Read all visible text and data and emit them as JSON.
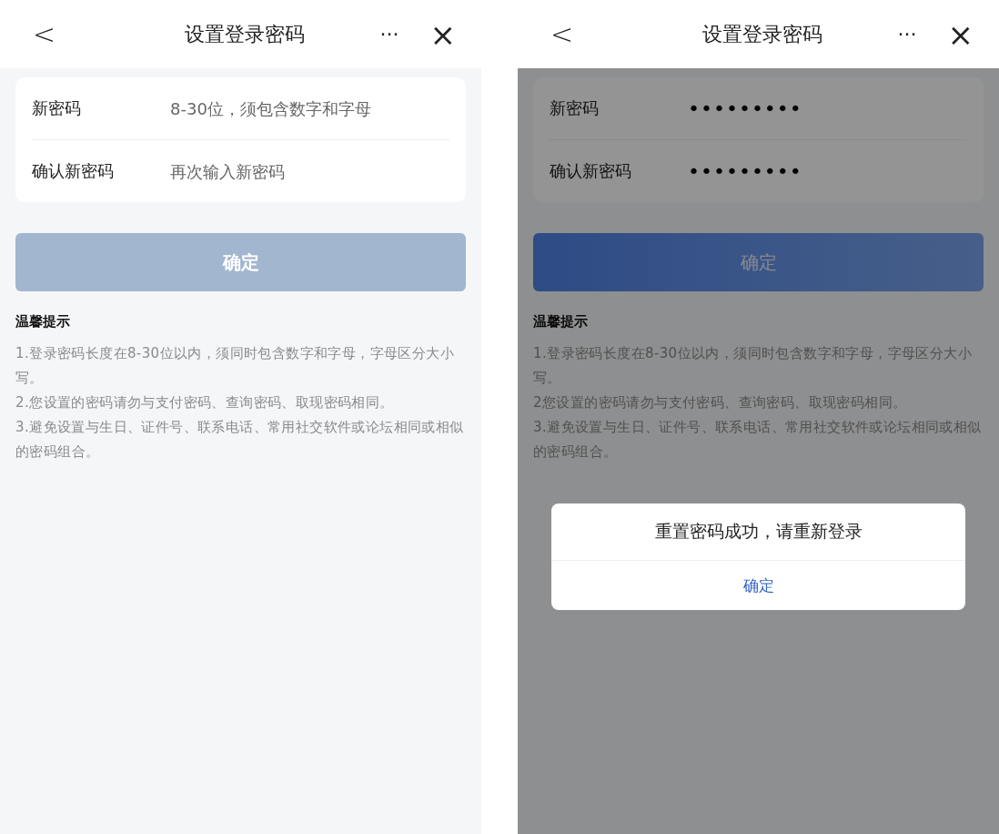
{
  "screens": [
    {
      "nav": {
        "back": "<",
        "title": "设置登录密码",
        "more": "···",
        "close": "×"
      },
      "fields": [
        {
          "label": "新密码",
          "placeholder": "8-30位，须包含数字和字母"
        },
        {
          "label": "确认新密码",
          "placeholder": "再次输入新密码"
        }
      ],
      "confirm_button": {
        "label": "确定",
        "disabled": true
      },
      "tips": {
        "title": "温馨提示",
        "items": [
          "1.登录密码长度在8-30位以内，须同时包含数字和字母，字母区分大小写。",
          "2.您设置的密码请勿与支付密码、查询密码、取现密码相同。",
          "3.避免设置与生日、证件号、联系电话、常用社交软件或论坛相同或相似的密码组合。"
        ]
      },
      "dimmed": false
    },
    {
      "nav": {
        "back": "<",
        "title": "设置登录密码",
        "more": "···",
        "close": "×"
      },
      "fields": [
        {
          "label": "新密码",
          "value": "•••••••••"
        },
        {
          "label": "确认新密码",
          "value": "•••••••••"
        }
      ],
      "confirm_button": {
        "label": "确定",
        "disabled": false
      },
      "tips": {
        "title": "温馨提示",
        "items": [
          "1.登录密码长度在8-30位以内，须同时包含数字和字母，字母区分大小写。",
          "2您设置的密码请勿与支付密码、查询密码、取现密码相同。",
          "3.避免设置与生日、证件号、联系电话、常用社交软件或论坛相同或相似的密码组合。"
        ]
      },
      "dimmed": true,
      "dialog": {
        "message": "重置密码成功，请重新登录",
        "button": "确定"
      }
    }
  ]
}
